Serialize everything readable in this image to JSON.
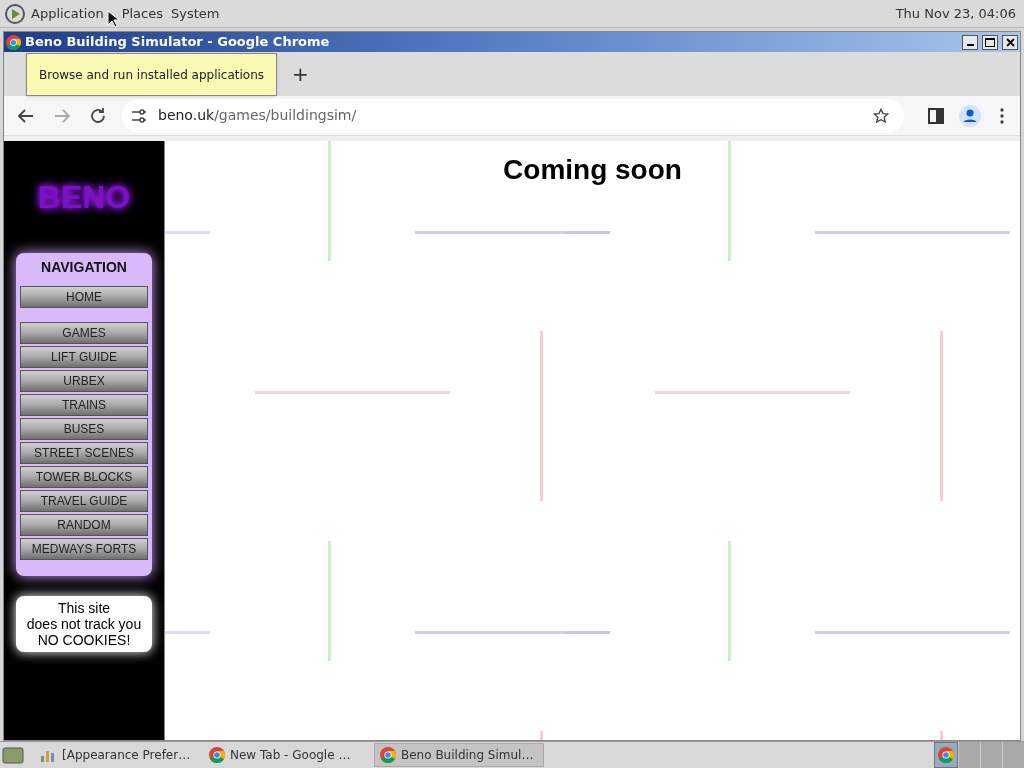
{
  "top_panel": {
    "menus": [
      "Application",
      "Places",
      "System"
    ],
    "clock": "Thu Nov 23, 04:06"
  },
  "window": {
    "title": "Beno Building Simulator - Google Chrome"
  },
  "tooltip": "Browse and run installed applications",
  "toolbar": {
    "new_tab": "+",
    "url_host": "beno.uk",
    "url_path": "/games/buildingsim/"
  },
  "page": {
    "logo": "BENO",
    "nav_title": "NAVIGATION",
    "nav_groups": [
      [
        "HOME"
      ],
      [
        "GAMES",
        "LIFT GUIDE",
        "URBEX",
        "TRAINS",
        "BUSES",
        "STREET SCENES",
        "TOWER BLOCKS",
        "TRAVEL GUIDE",
        "RANDOM",
        "MEDWAYS FORTS"
      ]
    ],
    "cookie_notice": [
      "This site",
      "does not track you",
      "NO COOKIES!"
    ],
    "heading": "Coming soon"
  },
  "taskbar": {
    "items": [
      {
        "label": "[Appearance Prefer…",
        "kind": "settings",
        "selected": false
      },
      {
        "label": "New Tab - Google …",
        "kind": "chrome",
        "selected": false
      },
      {
        "label": "Beno Building Simul…",
        "kind": "chrome",
        "selected": true
      }
    ]
  }
}
